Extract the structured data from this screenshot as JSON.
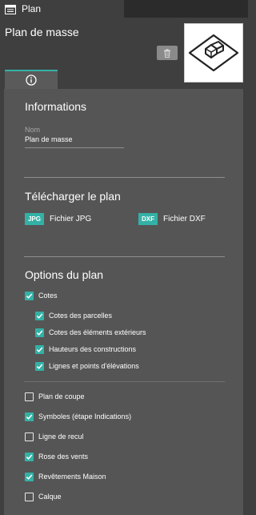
{
  "window": {
    "tab_title": "Plan",
    "page_title": "Plan de masse"
  },
  "colors": {
    "accent": "#34b1a6",
    "panel": "#555555",
    "background": "#3f3f3f"
  },
  "icons": {
    "window_tab": "window-icon",
    "delete": "trash-icon",
    "thumbnail": "house-plot-icon",
    "info_tab": "info-icon",
    "checkbox": "check-icon"
  },
  "informations": {
    "title": "Informations",
    "name_label": "Nom",
    "name_value": "Plan de masse"
  },
  "download": {
    "title": "Télécharger le plan",
    "jpg": {
      "badge": "JPG",
      "label": "Fichier JPG"
    },
    "dxf": {
      "badge": "DXF",
      "label": "Fichier DXF"
    }
  },
  "options": {
    "title": "Options du plan",
    "cotes": {
      "label": "Cotes",
      "checked": true
    },
    "cotes_children": [
      {
        "label": "Cotes des parcelles",
        "checked": true
      },
      {
        "label": "Cotes des éléments extérieurs",
        "checked": true
      },
      {
        "label": "Hauteurs des constructions",
        "checked": true
      },
      {
        "label": "Lignes et points d'élévations",
        "checked": true
      }
    ],
    "others": [
      {
        "label": "Plan de coupe",
        "checked": false
      },
      {
        "label": "Symboles (étape Indications)",
        "checked": true
      },
      {
        "label": "Ligne de recul",
        "checked": false
      },
      {
        "label": "Rose des vents",
        "checked": true
      },
      {
        "label": "Revêtements Maison",
        "checked": true
      },
      {
        "label": "Calque",
        "checked": false
      }
    ]
  }
}
